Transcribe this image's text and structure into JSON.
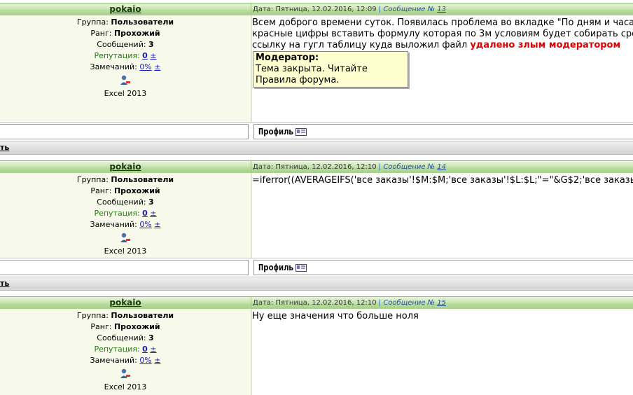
{
  "posts": [
    {
      "author": "pokaio",
      "date_label": "Дата:",
      "date": "Пятница, 12.02.2016, 12:09",
      "message_label": "Сообщение №",
      "message_number": "13",
      "group_label": "Группа:",
      "group": "Пользователи",
      "rank_label": "Ранг:",
      "rank": "Прохожий",
      "messages_label": "Сообщений:",
      "messages": "3",
      "reputation_label": "Репутация:",
      "reputation": "0",
      "reputation_pm": "±",
      "remarks_label": "Замечаний:",
      "remarks": "0%",
      "remarks_pm": "±",
      "version": "Excel 2013",
      "body_lines": [
        "Всем доброго времени суток. Появилась проблема во вкладке \"По дням и часам\" нужно",
        "красные цифры вставить формулу которая по 3м условиям будет собирать среднее",
        "ссылку на гугл таблицу куда выложил файл "
      ],
      "deleted_text": "удалено злым модератором",
      "moderator": {
        "title": "Модератор:",
        "line1": "Тема закрыта. Читайте",
        "line2": "Правила форума."
      },
      "profile_label": "Профиль",
      "strip_text": "ть"
    },
    {
      "author": "pokaio",
      "date_label": "Дата:",
      "date": "Пятница, 12.02.2016, 12:10",
      "message_label": "Сообщение №",
      "message_number": "14",
      "group_label": "Группа:",
      "group": "Пользователи",
      "rank_label": "Ранг:",
      "rank": "Прохожий",
      "messages_label": "Сообщений:",
      "messages": "3",
      "reputation_label": "Репутация:",
      "reputation": "0",
      "reputation_pm": "±",
      "remarks_label": "Замечаний:",
      "remarks": "0%",
      "remarks_pm": "±",
      "version": "Excel 2013",
      "body_lines": [
        "=iferror((AVERAGEIFS('все заказы'!$M:$M;'все заказы'!$L:$L;\"=\"&G$2;'все заказы'"
      ],
      "profile_label": "Профиль",
      "strip_text": "ть"
    },
    {
      "author": "pokaio",
      "date_label": "Дата:",
      "date": "Пятница, 12.02.2016, 12:10",
      "message_label": "Сообщение №",
      "message_number": "15",
      "group_label": "Группа:",
      "group": "Пользователи",
      "rank_label": "Ранг:",
      "rank": "Прохожий",
      "messages_label": "Сообщений:",
      "messages": "3",
      "reputation_label": "Репутация:",
      "reputation": "0",
      "reputation_pm": "±",
      "remarks_label": "Замечаний:",
      "remarks": "0%",
      "remarks_pm": "±",
      "version": "Excel 2013",
      "body_lines": [
        "Ну еще значения что больше ноля"
      ]
    }
  ],
  "icons": {
    "user": "user-remark-icon",
    "profile": "profile-card-icon"
  }
}
